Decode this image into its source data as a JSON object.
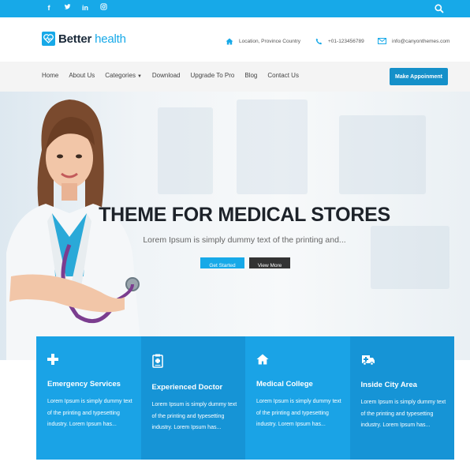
{
  "topbar": {
    "social_icons": [
      "facebook-icon",
      "twitter-icon",
      "linkedin-icon",
      "instagram-icon"
    ],
    "social_glyphs": [
      "f",
      "t",
      "in",
      "ig"
    ],
    "search_icon": "search-icon"
  },
  "header": {
    "logo_bold": "Better",
    "logo_light": " health",
    "location": "Location, Province Country",
    "phone": "+01-123456789",
    "email": "info@canyonthemes.com"
  },
  "nav": {
    "items": [
      "Home",
      "About Us",
      "Categories",
      "Download",
      "Upgrade To Pro",
      "Blog",
      "Contact Us"
    ],
    "cta_label": "Make Appoinment"
  },
  "hero": {
    "title": "THEME FOR MEDICAL STORES",
    "subtitle": "Lorem Ipsum is simply dummy text of the printing and...",
    "btn_primary": "Get Started",
    "btn_secondary": "View More"
  },
  "services": [
    {
      "icon": "plus-icon",
      "title": "Emergency Services",
      "text": "Lorem Ipsum is simply dummy text of the printing and typesetting industry. Lorem Ipsum has..."
    },
    {
      "icon": "clipboard-icon",
      "title": "Experienced Doctor",
      "text": "Lorem Ipsum is simply dummy text of the printing and typesetting industry. Lorem Ipsum has..."
    },
    {
      "icon": "home-icon",
      "title": "Medical College",
      "text": "Lorem Ipsum is simply dummy text of the printing and typesetting industry. Lorem Ipsum has..."
    },
    {
      "icon": "ambulance-icon",
      "title": "Inside City Area",
      "text": "Lorem Ipsum is simply dummy text of the printing and typesetting industry. Lorem Ipsum has..."
    }
  ],
  "colors": {
    "brand_blue": "#17a9e8",
    "card_colors": [
      "#1aa3e6",
      "#1694d6",
      "#1aa3e6",
      "#1694d6"
    ],
    "cta_blue": "#1590c9",
    "dark_button": "#333333"
  }
}
